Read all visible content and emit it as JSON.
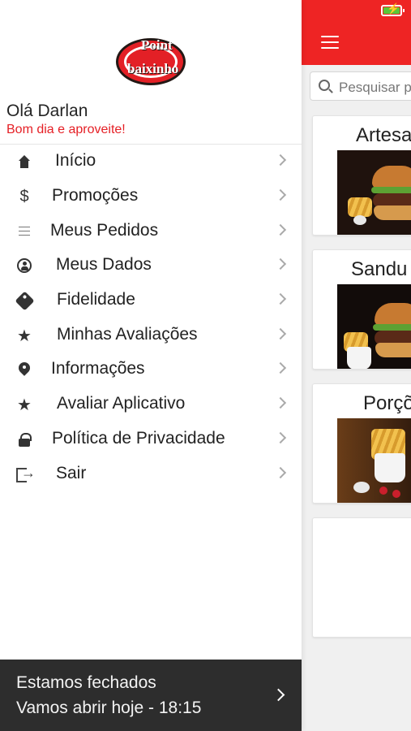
{
  "drawer": {
    "greeting": "Olá Darlan",
    "subtitle": "Bom dia e aproveite!",
    "logo": {
      "top": "Point",
      "bottom": "baixinho"
    },
    "menu": [
      {
        "label": "Início",
        "icon": "home-icon"
      },
      {
        "label": "Promoções",
        "icon": "dollar-icon"
      },
      {
        "label": "Meus Pedidos",
        "icon": "list-icon"
      },
      {
        "label": "Meus Dados",
        "icon": "user-icon"
      },
      {
        "label": "Fidelidade",
        "icon": "tag-icon"
      },
      {
        "label": "Minhas Avaliações",
        "icon": "star-icon"
      },
      {
        "label": "Informações",
        "icon": "pin-icon"
      },
      {
        "label": "Avaliar Aplicativo",
        "icon": "star-icon"
      },
      {
        "label": "Política de Privacidade",
        "icon": "lock-icon"
      },
      {
        "label": "Sair",
        "icon": "exit-icon"
      }
    ],
    "footer": {
      "line1": "Estamos fechados",
      "line2": "Vamos abrir hoje - 18:15"
    }
  },
  "background_app": {
    "search_placeholder": "Pesquisar p",
    "categories": [
      {
        "title": "Artesa",
        "icon": "burger-photo-icon"
      },
      {
        "title": "Sandu",
        "icon": "sandwich-photo-icon"
      },
      {
        "title": "Porçõ",
        "icon": "fries-photo-icon"
      }
    ]
  },
  "colors": {
    "accent": "#ee2424",
    "subtitle": "#e51f25",
    "footer": "#2d2d2d"
  }
}
